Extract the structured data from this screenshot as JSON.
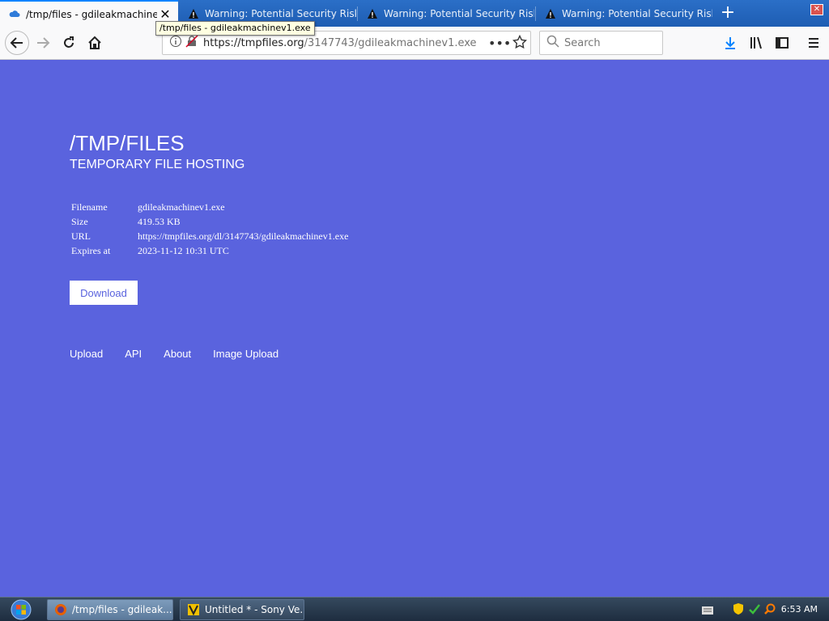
{
  "browser": {
    "tabs": [
      {
        "title": "/tmp/files - gdileakmachinev1.exe",
        "active": true
      },
      {
        "title": "Warning: Potential Security Risk Ahead",
        "active": false
      },
      {
        "title": "Warning: Potential Security Risk Ahead",
        "active": false
      },
      {
        "title": "Warning: Potential Security Risk Ahead",
        "active": false
      }
    ],
    "tooltip": "/tmp/files - gdileakmachinev1.exe",
    "url_prefix": "https://tmpfiles.org",
    "url_path": "/3147743/gdileakmachinev1.exe",
    "search_placeholder": "Search"
  },
  "page": {
    "title": "/TMP/FILES",
    "subtitle": "TEMPORARY FILE HOSTING",
    "fileinfo": [
      {
        "key": "Filename",
        "value": "gdileakmachinev1.exe"
      },
      {
        "key": "Size",
        "value": "419.53 KB"
      },
      {
        "key": "URL",
        "value": "https://tmpfiles.org/dl/3147743/gdileakmachinev1.exe"
      },
      {
        "key": "Expires at",
        "value": "2023-11-12 10:31 UTC"
      }
    ],
    "download_label": "Download",
    "footer_links": [
      "Upload",
      "API",
      "About",
      "Image Upload"
    ],
    "background_color": "#5a63de"
  },
  "taskbar": {
    "tasks": [
      {
        "label": "/tmp/files - gdileak...",
        "active": true
      },
      {
        "label": "Untitled * - Sony Ve...",
        "active": false
      }
    ],
    "clock": "6:53 AM"
  }
}
